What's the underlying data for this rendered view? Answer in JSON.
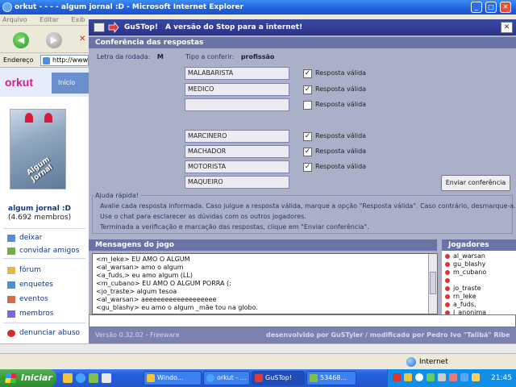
{
  "browser": {
    "title": "orkut - - - - algum jornal :D - Microsoft Internet Explorer",
    "menu": [
      "Arquivo",
      "Editar",
      "Exib"
    ],
    "address_label": "Endereço",
    "address_value": "http://www",
    "status_zone": "Internet"
  },
  "orkut": {
    "logo": "orkut",
    "nav_home": "Início",
    "image_caption": "Algum Jornal",
    "community_name": "algum jornal :D",
    "member_count": "(4.692 membros)",
    "links": [
      "deixar",
      "convidar amigos",
      "fórum",
      "enquetes",
      "eventos",
      "membros",
      "denunciar abuso"
    ]
  },
  "app": {
    "name": "GuSTop!",
    "tagline": "A versão do Stop para a internet!",
    "section_title": "Conferência das respostas",
    "letter_label": "Letra da rodada:",
    "letter_value": "M",
    "type_label": "Tipo a conferir:",
    "type_value": "profissão",
    "valid_label": "Resposta válida",
    "answers": [
      {
        "text": "MALABARISTA",
        "checked": true
      },
      {
        "text": "MEDICO",
        "checked": true
      },
      {
        "text": "",
        "checked": false
      },
      {
        "text": "MARCINERO",
        "checked": true
      },
      {
        "text": "MACHADOR",
        "checked": true
      },
      {
        "text": "MOTORISTA",
        "checked": true
      },
      {
        "text": "MAQUEIRO",
        "checked": false
      }
    ],
    "send_button": "Enviar conferência",
    "help_title": "Ajuda rápida!",
    "help_lines": [
      "Avalie cada resposta informada. Caso julgue a resposta válida, marque a opção \"Resposta válida\". Caso contrário, desmarque-a.",
      "Use o chat para esclarecer as dúvidas com os outros jogadores.",
      "Terminada a verificação e marcação das respostas, clique em \"Enviar conferência\"."
    ],
    "messages_title": "Mensagens do jogo",
    "messages": [
      "<m_leke> EU AMO O ALGUM",
      "<al_warsan> amo o algum",
      "<a_fuds,> eu amo algum (LL)",
      "<m_cubano> EU AMO O ALGUM PORRA (:",
      "<jo_traste> algum tesoa",
      "<al_warsan> aeeeeeeeeeeeeeeeeee",
      "<gu_blashy> eu amo o algum _mãe tou na globo."
    ],
    "players_title": "Jogadores",
    "players": [
      "al_warsan",
      "gu_blashy",
      "m_cubano",
      "",
      "jo_traste",
      "rn_leke",
      "a_fuds,",
      "l_anonima"
    ],
    "version": "Versão 0.32.02 - Freeware",
    "credits": "desenvolvido por GuSTyler / modificado por Pedro Ivo \"Talibã\" Ribe"
  },
  "taskbar": {
    "start_label": "Iniciar",
    "tasks": [
      "Windo...",
      "orkut - ...",
      "GuSTop!",
      "53468..."
    ],
    "clock": "21:45"
  }
}
